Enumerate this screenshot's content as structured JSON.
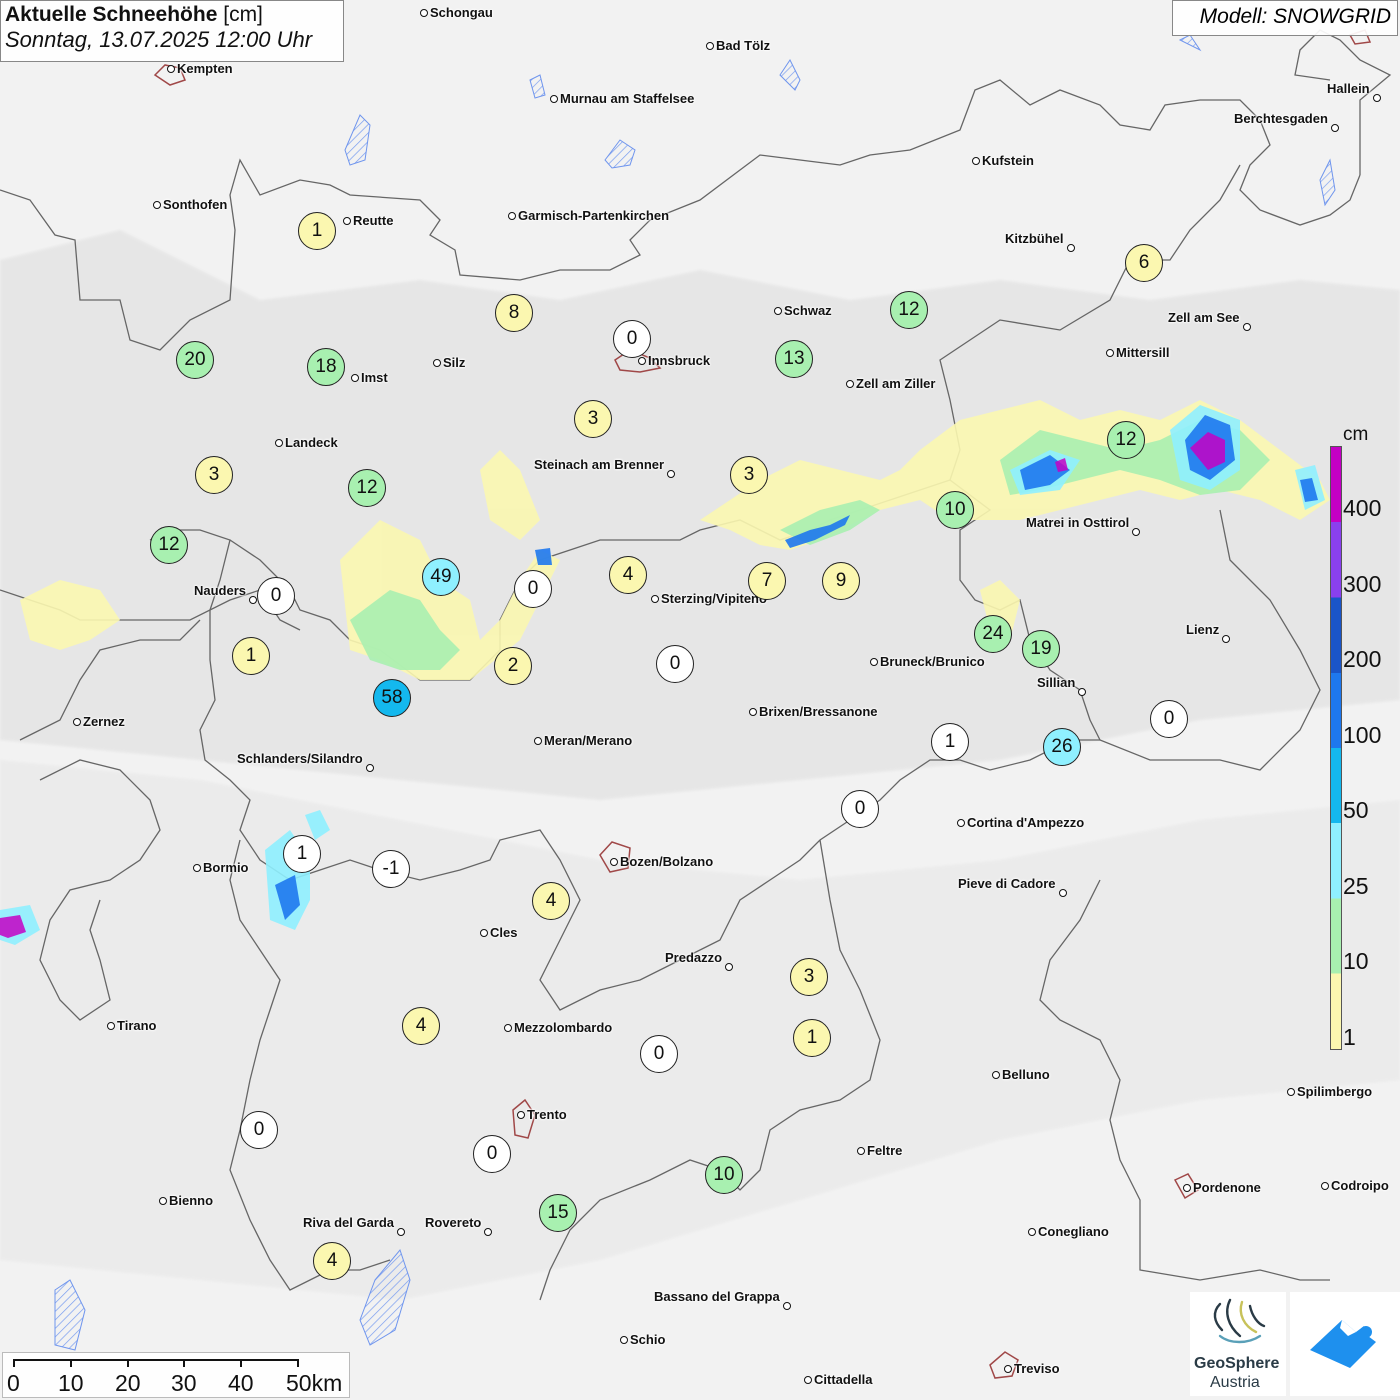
{
  "title": {
    "main": "Aktuelle Schneehöhe",
    "unit": "[cm]",
    "date": "Sonntag, 13.07.2025 12:00 Uhr"
  },
  "model": "Modell: SNOWGRID",
  "legend": {
    "unit": "cm",
    "ticks": [
      "400",
      "300",
      "200",
      "100",
      "50",
      "25",
      "10",
      "1"
    ],
    "colors": [
      "#c400c4",
      "#8a40ee",
      "#1a55c8",
      "#1e78ee",
      "#14b8ee",
      "#8ff0ff",
      "#a8f0b0",
      "#fbf7b0"
    ]
  },
  "scale": {
    "labels": [
      "0",
      "10",
      "20",
      "30",
      "40",
      "50km"
    ]
  },
  "logos": {
    "geosphere_line1": "GeoSphere",
    "geosphere_line2": "Austria"
  },
  "cities": [
    {
      "name": "Schongau"
    },
    {
      "name": "Bad Tölz"
    },
    {
      "name": "Kempten"
    },
    {
      "name": "Murnau am Staffelsee"
    },
    {
      "name": "Hallein"
    },
    {
      "name": "Berchtesgaden"
    },
    {
      "name": "Kufstein"
    },
    {
      "name": "Sonthofen"
    },
    {
      "name": "Reutte"
    },
    {
      "name": "Garmisch-Partenkirchen"
    },
    {
      "name": "Kitzbühel"
    },
    {
      "name": "Schwaz"
    },
    {
      "name": "Zell am See"
    },
    {
      "name": "Innsbruck"
    },
    {
      "name": "Silz"
    },
    {
      "name": "Imst"
    },
    {
      "name": "Mittersill"
    },
    {
      "name": "Zell am Ziller"
    },
    {
      "name": "Landeck"
    },
    {
      "name": "Steinach am Brenner"
    },
    {
      "name": "Matrei in Osttirol"
    },
    {
      "name": "Nauders"
    },
    {
      "name": "Sterzing/Vipiteno"
    },
    {
      "name": "Lienz"
    },
    {
      "name": "Bruneck/Brunico"
    },
    {
      "name": "Sillian"
    },
    {
      "name": "Zernez"
    },
    {
      "name": "Brixen/Bressanone"
    },
    {
      "name": "Meran/Merano"
    },
    {
      "name": "Schlanders/Silandro"
    },
    {
      "name": "Cortina d'Ampezzo"
    },
    {
      "name": "Bozen/Bolzano"
    },
    {
      "name": "Bormio"
    },
    {
      "name": "Pieve di Cadore"
    },
    {
      "name": "Cles"
    },
    {
      "name": "Predazzo"
    },
    {
      "name": "Tirano"
    },
    {
      "name": "Mezzolombardo"
    },
    {
      "name": "Belluno"
    },
    {
      "name": "Spilimbergo"
    },
    {
      "name": "Trento"
    },
    {
      "name": "Feltre"
    },
    {
      "name": "Pordenone"
    },
    {
      "name": "Codroipo"
    },
    {
      "name": "Bienno"
    },
    {
      "name": "Riva del Garda"
    },
    {
      "name": "Rovereto"
    },
    {
      "name": "Conegliano"
    },
    {
      "name": "Bassano del Grappa"
    },
    {
      "name": "Schio"
    },
    {
      "name": "Treviso"
    },
    {
      "name": "Cittadella"
    }
  ],
  "stations": [
    {
      "value": 1,
      "color": "#fbf7b0"
    },
    {
      "value": 8,
      "color": "#fbf7b0"
    },
    {
      "value": 0,
      "color": "#ffffff"
    },
    {
      "value": 6,
      "color": "#fbf7b0"
    },
    {
      "value": 12,
      "color": "#a8f0b0"
    },
    {
      "value": 20,
      "color": "#a8f0b0"
    },
    {
      "value": 18,
      "color": "#a8f0b0"
    },
    {
      "value": 13,
      "color": "#a8f0b0"
    },
    {
      "value": 3,
      "color": "#fbf7b0"
    },
    {
      "value": 12,
      "color": "#a8f0b0"
    },
    {
      "value": 3,
      "color": "#fbf7b0"
    },
    {
      "value": 3,
      "color": "#fbf7b0"
    },
    {
      "value": 12,
      "color": "#a8f0b0"
    },
    {
      "value": 10,
      "color": "#a8f0b0"
    },
    {
      "value": 12,
      "color": "#a8f0b0"
    },
    {
      "value": 49,
      "color": "#8ff0ff"
    },
    {
      "value": 0,
      "color": "#ffffff"
    },
    {
      "value": 4,
      "color": "#fbf7b0"
    },
    {
      "value": 7,
      "color": "#fbf7b0"
    },
    {
      "value": 9,
      "color": "#fbf7b0"
    },
    {
      "value": 0,
      "color": "#ffffff"
    },
    {
      "value": 24,
      "color": "#a8f0b0"
    },
    {
      "value": 19,
      "color": "#a8f0b0"
    },
    {
      "value": 1,
      "color": "#fbf7b0"
    },
    {
      "value": 2,
      "color": "#fbf7b0"
    },
    {
      "value": 0,
      "color": "#ffffff"
    },
    {
      "value": 58,
      "color": "#14b8ee"
    },
    {
      "value": 0,
      "color": "#ffffff"
    },
    {
      "value": 1,
      "color": "#ffffff"
    },
    {
      "value": 26,
      "color": "#8ff0ff"
    },
    {
      "value": 0,
      "color": "#ffffff"
    },
    {
      "value": 1,
      "color": "#ffffff"
    },
    {
      "value": -1,
      "color": "#ffffff"
    },
    {
      "value": 4,
      "color": "#fbf7b0"
    },
    {
      "value": 3,
      "color": "#fbf7b0"
    },
    {
      "value": 4,
      "color": "#fbf7b0"
    },
    {
      "value": 1,
      "color": "#fbf7b0"
    },
    {
      "value": 0,
      "color": "#ffffff"
    },
    {
      "value": 0,
      "color": "#ffffff"
    },
    {
      "value": 0,
      "color": "#ffffff"
    },
    {
      "value": 10,
      "color": "#a8f0b0"
    },
    {
      "value": 15,
      "color": "#a8f0b0"
    },
    {
      "value": 4,
      "color": "#fbf7b0"
    }
  ]
}
